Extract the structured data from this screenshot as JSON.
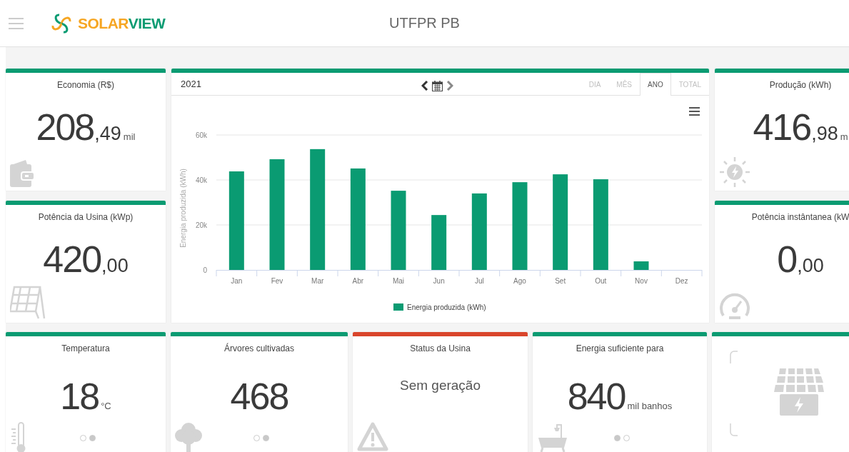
{
  "header": {
    "logo": {
      "part_1": "SOLAR",
      "part_2": "VIEW"
    },
    "title": "UTFPR PB"
  },
  "left_cards": [
    {
      "kind": "wallet",
      "title": "Economia (R$)",
      "integer": "208",
      "decimal": ",49",
      "unit": "mil",
      "color": "#0a9b72"
    },
    {
      "kind": "panel_stand",
      "title": "Potência da Usina (kWp)",
      "integer": "420",
      "decimal": ",00",
      "color": "#0a9b72"
    }
  ],
  "chart_panel": {
    "period": "2021",
    "tabs": [
      {
        "label": "DIA",
        "selected": false
      },
      {
        "label": "MÊS",
        "selected": false
      },
      {
        "label": "ANO",
        "selected": true
      },
      {
        "label": "TOTAL",
        "selected": false
      }
    ],
    "chart_data": {
      "type": "bar",
      "ylabel": "Energia produzida (kWh)",
      "categories": [
        "Jan",
        "Fev",
        "Mar",
        "Abr",
        "Mai",
        "Jun",
        "Jul",
        "Ago",
        "Set",
        "Out",
        "Nov",
        "Dez"
      ],
      "series": [
        {
          "name": "Energia produzida (kWh)",
          "color": "#0a9b72",
          "values": [
            43800,
            49200,
            53700,
            45100,
            35200,
            24400,
            34000,
            39000,
            42500,
            40300,
            3800,
            0
          ]
        }
      ],
      "ylim": [
        0,
        60000
      ],
      "yticks": [
        {
          "value": 0,
          "label": "0"
        },
        {
          "value": 20000,
          "label": "20k"
        },
        {
          "value": 40000,
          "label": "40k"
        },
        {
          "value": 60000,
          "label": "60k"
        }
      ]
    }
  },
  "right_cards": [
    {
      "kind": "sun",
      "title": "Produção (kWh)",
      "integer": "416",
      "decimal": ",98",
      "unit": "m",
      "color": "#0a9b72"
    },
    {
      "kind": "gauge",
      "title": "Potência instântanea (kW",
      "integer": "0",
      "decimal": ",00",
      "color": "#0a9b72"
    }
  ],
  "bottom_cards": [
    {
      "kind": "thermometer",
      "title": "Temperatura",
      "integer": "18",
      "unit": "°C",
      "color": "#0a9b72",
      "pager": [
        {
          "selected": false
        },
        {
          "selected": true
        }
      ]
    },
    {
      "kind": "tree",
      "title": "Árvores cultivadas",
      "integer": "468",
      "color": "#0a9b72",
      "pager": [
        {
          "selected": false
        },
        {
          "selected": true
        }
      ]
    },
    {
      "kind": "warning",
      "title": "Status da Usina",
      "text": "Sem geração",
      "color": "#d9452b"
    },
    {
      "kind": "bath",
      "title": "Energia suficiente para",
      "integer": "840",
      "unit": "mil banhos",
      "color": "#0a9b72",
      "pager": [
        {
          "selected": true
        },
        {
          "selected": false
        }
      ]
    },
    {
      "kind": "panel_bolt",
      "color": "#0a9b72"
    }
  ]
}
